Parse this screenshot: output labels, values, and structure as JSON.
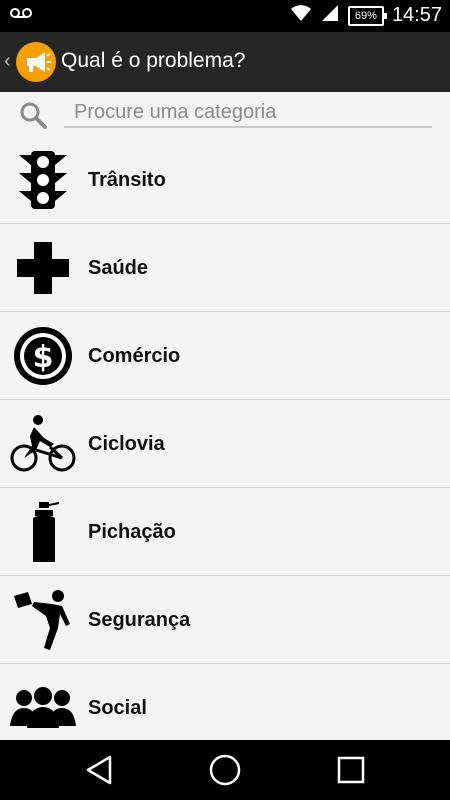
{
  "status_bar": {
    "time": "14:57",
    "battery": "69%",
    "icons": [
      "voicemail-icon",
      "wifi-icon",
      "signal-icon",
      "battery-icon"
    ]
  },
  "action_bar": {
    "title": "Qual é o problema?",
    "app_icon": "megaphone-icon",
    "accent": "#f5a000"
  },
  "search": {
    "placeholder": "Procure uma categoria",
    "value": ""
  },
  "categories": [
    {
      "label": "Trânsito",
      "icon": "traffic-light-icon"
    },
    {
      "label": "Saúde",
      "icon": "health-cross-icon"
    },
    {
      "label": "Comércio",
      "icon": "dollar-coin-icon"
    },
    {
      "label": "Ciclovia",
      "icon": "cyclist-icon"
    },
    {
      "label": "Pichação",
      "icon": "spray-can-icon"
    },
    {
      "label": "Segurança",
      "icon": "robbery-icon"
    },
    {
      "label": "Social",
      "icon": "people-group-icon"
    }
  ],
  "nav_bar": {
    "buttons": [
      "back-icon",
      "home-icon",
      "recents-icon"
    ]
  }
}
